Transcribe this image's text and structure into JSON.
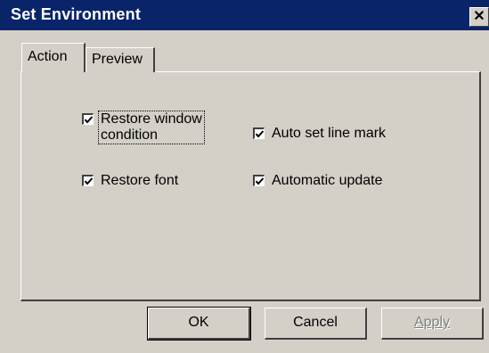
{
  "window": {
    "title": "Set Environment",
    "close_glyph": "✕"
  },
  "tabs": [
    {
      "label": "Action",
      "selected": true
    },
    {
      "label": "Preview",
      "selected": false
    }
  ],
  "options": {
    "restore_window_condition": {
      "label": "Restore window\ncondition",
      "checked": true
    },
    "auto_set_line_mark": {
      "label": "Auto set line mark",
      "checked": true
    },
    "restore_font": {
      "label": "Restore font",
      "checked": true
    },
    "automatic_update": {
      "label": "Automatic update",
      "checked": true
    }
  },
  "buttons": {
    "ok": "OK",
    "cancel": "Cancel",
    "apply": "Apply"
  },
  "colors": {
    "titlebar": "#0a246a",
    "face": "#d4d0c8"
  }
}
